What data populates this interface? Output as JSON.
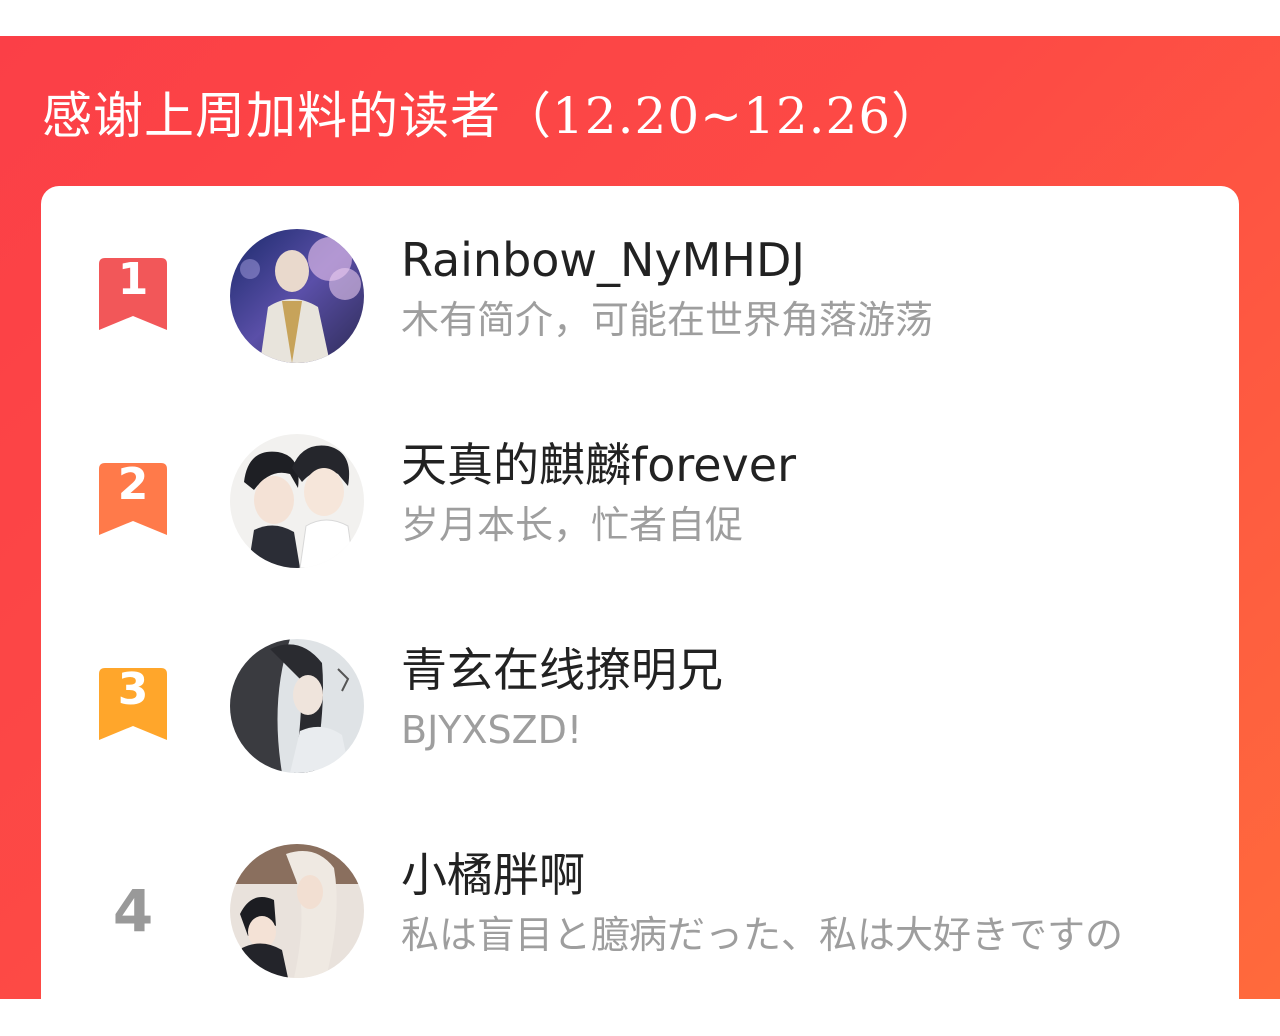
{
  "header": {
    "title": "感谢上周加料的读者（12.20~12.26）"
  },
  "colors": {
    "panel_start": "#fb3f47",
    "panel_end": "#ff6a3c",
    "rank1": "#f25759",
    "rank2": "#ff7a4a",
    "rank3": "#ffa62b",
    "rank_plain": "#999999"
  },
  "readers": [
    {
      "rank": "1",
      "name": "Rainbow_NyMHDJ",
      "bio": "木有简介，可能在世界角落游荡",
      "avatar": "avatar-icon"
    },
    {
      "rank": "2",
      "name": "天真的麒麟forever",
      "bio": "岁月本长，忙者自促",
      "avatar": "avatar-icon"
    },
    {
      "rank": "3",
      "name": "青玄在线撩明兄",
      "bio": "BJYXSZD!",
      "avatar": "avatar-icon"
    },
    {
      "rank": "4",
      "name": "小橘胖啊",
      "bio": "私は盲目と臆病だった、私は大好きですの",
      "avatar": "avatar-icon"
    }
  ]
}
